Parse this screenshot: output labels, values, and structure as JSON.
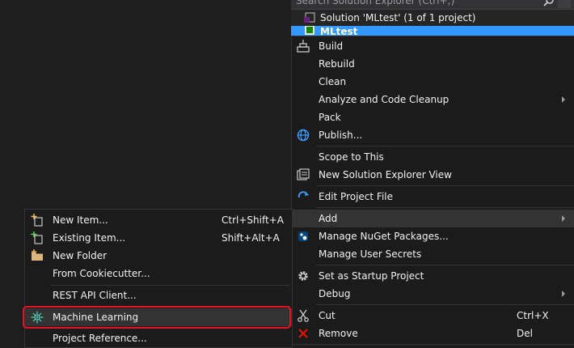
{
  "solution_explorer": {
    "search_placeholder": "Search Solution Explorer (Ctrl+;)",
    "solution_label": "Solution 'MLtest' (1 of 1 project)",
    "project_label": "MLtest"
  },
  "context_menu": {
    "build": "Build",
    "rebuild": "Rebuild",
    "clean": "Clean",
    "analyze": "Analyze and Code Cleanup",
    "pack": "Pack",
    "publish": "Publish...",
    "scope": "Scope to This",
    "new_view": "New Solution Explorer View",
    "edit_project": "Edit Project File",
    "add": "Add",
    "nuget": "Manage NuGet Packages...",
    "user_secrets": "Manage User Secrets",
    "startup": "Set as Startup Project",
    "debug": "Debug",
    "cut": "Cut",
    "cut_shortcut": "Ctrl+X",
    "remove": "Remove",
    "remove_shortcut": "Del"
  },
  "add_submenu": {
    "new_item": "New Item...",
    "new_item_shortcut": "Ctrl+Shift+A",
    "existing_item": "Existing Item...",
    "existing_item_shortcut": "Shift+Alt+A",
    "new_folder": "New Folder",
    "cookiecutter": "From Cookiecutter...",
    "rest_api": "REST API Client...",
    "machine_learning": "Machine Learning",
    "project_reference": "Project Reference..."
  }
}
